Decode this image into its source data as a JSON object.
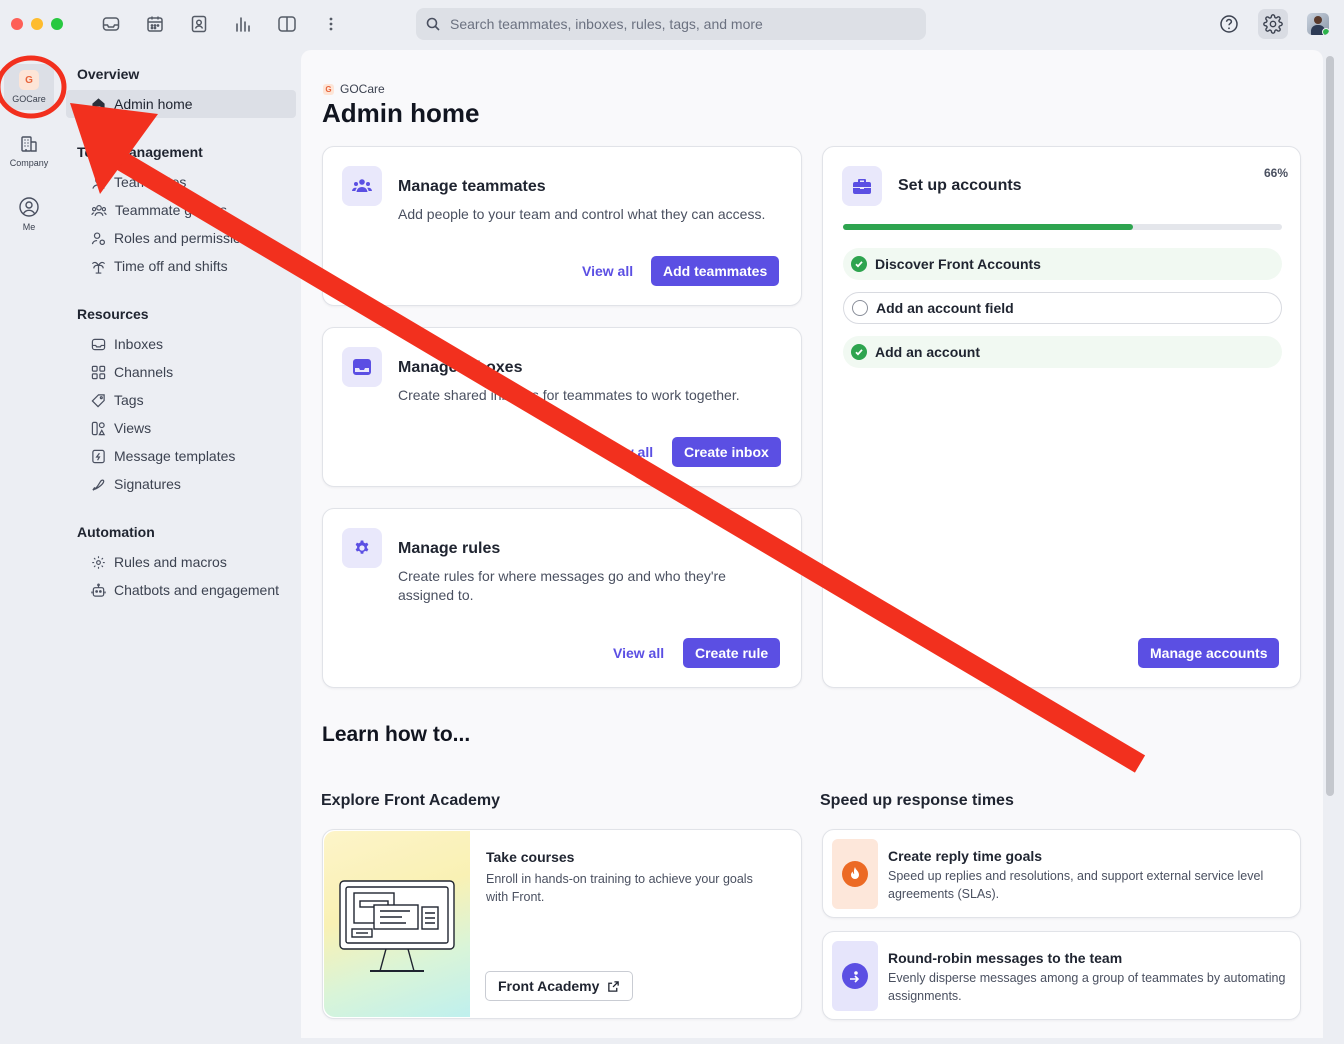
{
  "titlebar": {
    "search_placeholder": "Search teammates, inboxes, rules, tags, and more",
    "icons": [
      "inbox-icon",
      "calendar-icon",
      "contacts-icon",
      "analytics-icon",
      "split-view-icon",
      "more-icon"
    ],
    "right_icons": [
      "help-icon",
      "settings-gear-icon",
      "user-avatar"
    ]
  },
  "rail": {
    "items": [
      {
        "label": "GOCare",
        "badge": "G"
      },
      {
        "label": "Company"
      },
      {
        "label": "Me"
      }
    ]
  },
  "sidebar": {
    "overview": {
      "title": "Overview",
      "items": [
        {
          "label": "Admin home",
          "icon": "home-icon"
        }
      ]
    },
    "team": {
      "title": "Team management",
      "items": [
        {
          "label": "Teammates",
          "icon": "person-icon"
        },
        {
          "label": "Teammate groups",
          "icon": "group-icon"
        },
        {
          "label": "Roles and permissions",
          "icon": "role-icon"
        },
        {
          "label": "Time off and shifts",
          "icon": "palm-tree-icon"
        }
      ]
    },
    "resources": {
      "title": "Resources",
      "items": [
        {
          "label": "Inboxes",
          "icon": "inbox-icon"
        },
        {
          "label": "Channels",
          "icon": "channels-icon"
        },
        {
          "label": "Tags",
          "icon": "tag-icon"
        },
        {
          "label": "Views",
          "icon": "views-icon"
        },
        {
          "label": "Message templates",
          "icon": "template-icon"
        },
        {
          "label": "Signatures",
          "icon": "signature-icon"
        }
      ]
    },
    "automation": {
      "title": "Automation",
      "items": [
        {
          "label": "Rules and macros",
          "icon": "gear-icon"
        },
        {
          "label": "Chatbots and engagement",
          "icon": "bot-icon"
        }
      ]
    }
  },
  "main": {
    "breadcrumb": {
      "badge": "G",
      "label": "GOCare"
    },
    "title": "Admin home",
    "cards": [
      {
        "title": "Manage teammates",
        "description": "Add people to your team and control what they can access.",
        "link": "View all",
        "button": "Add teammates"
      },
      {
        "title": "Manage inboxes",
        "description": "Create shared inboxes for teammates to work together.",
        "link": "View all",
        "button": "Create inbox"
      },
      {
        "title": "Manage rules",
        "description": "Create rules for where messages go and who they're assigned to.",
        "link": "View all",
        "button": "Create rule"
      }
    ],
    "accounts": {
      "title": "Set up accounts",
      "percent_label": "66%",
      "progress": 0.66,
      "tasks": [
        {
          "label": "Discover Front Accounts",
          "done": true
        },
        {
          "label": "Add an account field",
          "done": false
        },
        {
          "label": "Add an account",
          "done": true
        }
      ],
      "button": "Manage accounts"
    },
    "learn": {
      "title": "Learn how to...",
      "academy": {
        "heading": "Explore Front Academy",
        "card_title": "Take courses",
        "card_desc": "Enroll in hands-on training to achieve your goals with Front.",
        "button": "Front Academy"
      },
      "speed": {
        "heading": "Speed up response times",
        "items": [
          {
            "title": "Create reply time goals",
            "desc": "Speed up replies and resolutions, and support external service level agreements (SLAs).",
            "icon": "flame-icon",
            "color": "#ec6a24"
          },
          {
            "title": "Round-robin messages to the team",
            "desc": "Evenly disperse messages among a group of teammates by automating assignments.",
            "icon": "round-robin-icon",
            "color": "#5b4fe3"
          }
        ]
      }
    }
  },
  "annotation": {
    "color": "#f2301e",
    "shape": "red arrow and circle highlighting the GOCare workspace"
  },
  "colors": {
    "accent": "#5b4fe3",
    "success": "#2ea44f",
    "annotation": "#f2301e"
  }
}
